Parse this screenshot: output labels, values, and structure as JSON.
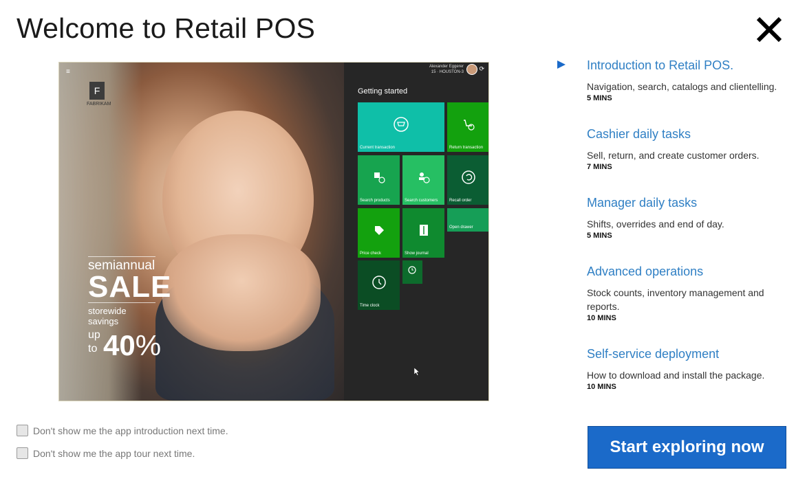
{
  "header": {
    "title": "Welcome to Retail POS"
  },
  "video": {
    "brand": {
      "letter": "F",
      "name": "FABRIKAM"
    },
    "promo": {
      "line1": "semiannual",
      "line2": "SALE",
      "line3": "storewide savings",
      "up": "up",
      "to": "to",
      "percent": "40",
      "percent_sign": "%"
    },
    "user": {
      "name": "Alexander Eggerer",
      "store": "15 · HOUSTON-3"
    },
    "section_title": "Getting started",
    "tiles": [
      {
        "label": "Current transaction",
        "icon": "cart-icon",
        "color": "#0fbfa8"
      },
      {
        "label": "Return transaction",
        "icon": "return-cart-icon",
        "color": "#13a10e"
      },
      {
        "label": "Search products",
        "icon": "product-search-icon",
        "color": "#17a44f"
      },
      {
        "label": "Search customers",
        "icon": "customer-search-icon",
        "color": "#26bf63"
      },
      {
        "label": "Recall order",
        "icon": "recall-icon",
        "color": "#0b5d33"
      },
      {
        "label": "Open drawer",
        "icon": "",
        "color": "#169e57"
      },
      {
        "label": "Price check",
        "icon": "tag-icon",
        "color": "#13a10e"
      },
      {
        "label": "Show journal",
        "icon": "journal-icon",
        "color": "#0f8a2f"
      },
      {
        "label": "",
        "icon": "clock-list-icon",
        "color": "#0d6b2c"
      },
      {
        "label": "Time clock",
        "icon": "clock-icon",
        "color": "#0b4d24"
      }
    ]
  },
  "topics": [
    {
      "title": "Introduction to Retail POS.",
      "desc": "Navigation, search, catalogs and clientelling.",
      "mins": "5 MINS"
    },
    {
      "title": "Cashier daily tasks",
      "desc": "Sell, return, and create customer orders.",
      "mins": "7 MINS"
    },
    {
      "title": "Manager daily tasks",
      "desc": "Shifts, overrides and end of day.",
      "mins": "5 MINS"
    },
    {
      "title": "Advanced operations",
      "desc": "Stock counts, inventory management and reports.",
      "mins": "10 MINS"
    },
    {
      "title": "Self-service deployment",
      "desc": "How to download and install the package.",
      "mins": "10 MINS"
    }
  ],
  "checkboxes": [
    {
      "label": "Don't show me the app introduction next time.",
      "checked": false
    },
    {
      "label": "Don't show me the app tour next time.",
      "checked": false
    }
  ],
  "cta": {
    "label": "Start exploring now"
  },
  "colors": {
    "accent": "#1b6ac9",
    "link": "#2f7fc4"
  }
}
